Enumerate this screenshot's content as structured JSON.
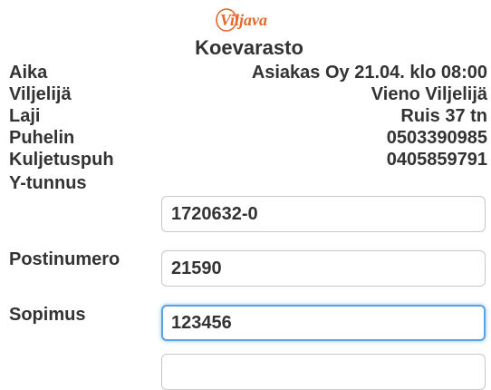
{
  "brand": {
    "logo_text": "Viljava",
    "accent_color": "#e4682a"
  },
  "page": {
    "title": "Koevarasto"
  },
  "info": [
    {
      "label": "Aika",
      "value": "Asiakas Oy 21.04. klo 08:00"
    },
    {
      "label": "Viljelijä",
      "value": "Vieno Viljelijä"
    },
    {
      "label": "Laji",
      "value": "Ruis 37 tn"
    },
    {
      "label": "Puhelin",
      "value": "0503390985"
    },
    {
      "label": "Kuljetuspuh",
      "value": "0405859791"
    }
  ],
  "fields": [
    {
      "label": "Y-tunnus",
      "value": "1720632-0"
    },
    {
      "label": "Postinumero",
      "value": "21590"
    },
    {
      "label": "Sopimus",
      "value": "123456",
      "focused": true
    },
    {
      "label": "",
      "value": ""
    }
  ],
  "colors": {
    "focus_border": "#5aa2e0",
    "input_border": "#c8c8c8",
    "text": "#333333"
  }
}
